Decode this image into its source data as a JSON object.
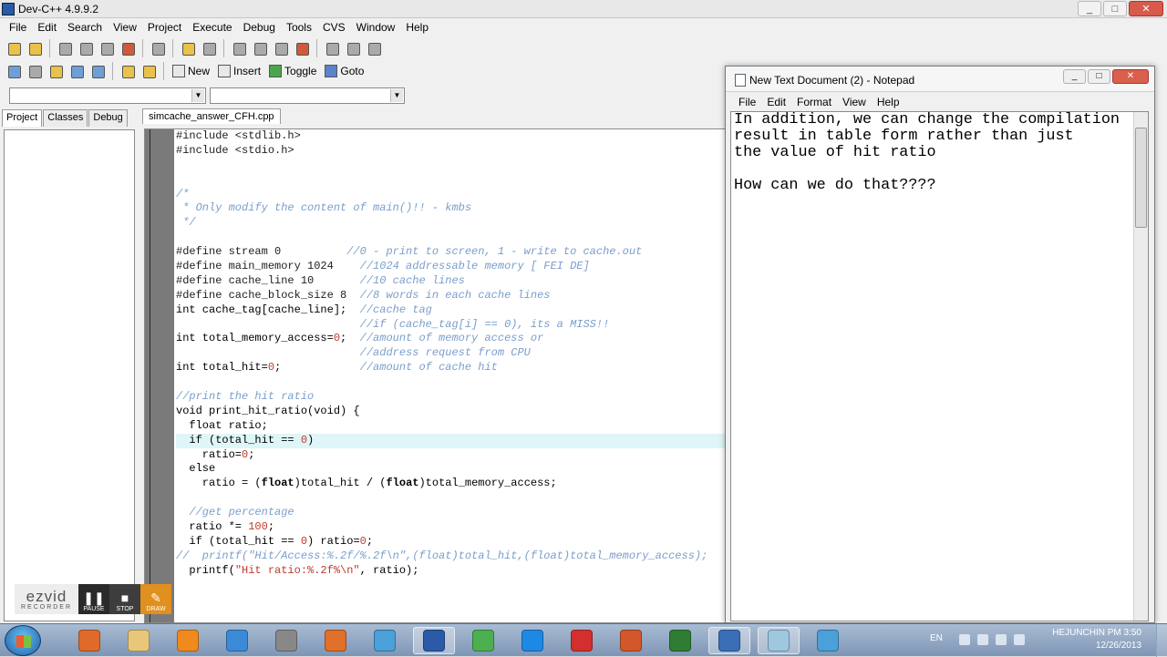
{
  "devcpp": {
    "title": "Dev-C++ 4.9.9.2",
    "window_buttons": [
      "_",
      "□",
      "✕"
    ],
    "menu": [
      "File",
      "Edit",
      "Search",
      "View",
      "Project",
      "Execute",
      "Debug",
      "Tools",
      "CVS",
      "Window",
      "Help"
    ],
    "toolbar2_labels": {
      "new": "New",
      "insert": "Insert",
      "toggle": "Toggle",
      "goto": "Goto"
    },
    "panel_tabs": [
      "Project",
      "Classes",
      "Debug"
    ],
    "file_tab": "simcache_answer_CFH.cpp"
  },
  "code_lines": [
    [
      [
        "pp",
        "#include <stdlib.h>"
      ]
    ],
    [
      [
        "pp",
        "#include <stdio.h>"
      ]
    ],
    [],
    [],
    [
      [
        "cm",
        "/*"
      ]
    ],
    [
      [
        "cm",
        " * Only modify the content of main()!! - kmbs"
      ]
    ],
    [
      [
        "cm",
        " */"
      ]
    ],
    [],
    [
      [
        "pp",
        "#define stream 0          "
      ],
      [
        "cm",
        "//0 - print to screen, 1 - write to cache.out"
      ]
    ],
    [
      [
        "pp",
        "#define main_memory 1024    "
      ],
      [
        "cm",
        "//1024 addressable memory [ FEI DE]"
      ]
    ],
    [
      [
        "pp",
        "#define cache_line 10       "
      ],
      [
        "cm",
        "//10 cache lines"
      ]
    ],
    [
      [
        "pp",
        "#define cache_block_size 8  "
      ],
      [
        "cm",
        "//8 words in each cache lines"
      ]
    ],
    [
      [
        "tx",
        "int cache_tag[cache_line];  "
      ],
      [
        "cm",
        "//cache tag"
      ]
    ],
    [
      [
        "tx",
        "                            "
      ],
      [
        "cm",
        "//if (cache_tag[i] == 0), its a MISS!!"
      ]
    ],
    [
      [
        "tx",
        "int total_memory_access="
      ],
      [
        "nm",
        "0"
      ],
      [
        "tx",
        ";  "
      ],
      [
        "cm",
        "//amount of memory access or"
      ]
    ],
    [
      [
        "tx",
        "                            "
      ],
      [
        "cm",
        "//address request from CPU"
      ]
    ],
    [
      [
        "tx",
        "int total_hit="
      ],
      [
        "nm",
        "0"
      ],
      [
        "tx",
        ";            "
      ],
      [
        "cm",
        "//amount of cache hit"
      ]
    ],
    [],
    [
      [
        "cm",
        "//print the hit ratio"
      ]
    ],
    [
      [
        "tx",
        "void print_hit_ratio(void) {"
      ]
    ],
    [
      [
        "tx",
        "  float ratio;"
      ]
    ],
    [
      [
        "tx",
        "  if (total_hit == "
      ],
      [
        "nm",
        "0"
      ],
      [
        "tx",
        ")"
      ]
    ],
    [
      [
        "tx",
        "    ratio="
      ],
      [
        "nm",
        "0"
      ],
      [
        "tx",
        ";"
      ]
    ],
    [
      [
        "tx",
        "  else"
      ]
    ],
    [
      [
        "tx",
        "    ratio = ("
      ],
      [
        "kw",
        "float"
      ],
      [
        "tx",
        ")total_hit / ("
      ],
      [
        "kw",
        "float"
      ],
      [
        "tx",
        ")total_memory_access;"
      ]
    ],
    [],
    [
      [
        "cm",
        "  //get percentage"
      ]
    ],
    [
      [
        "tx",
        "  ratio *= "
      ],
      [
        "nm",
        "100"
      ],
      [
        "tx",
        ";"
      ]
    ],
    [
      [
        "tx",
        "  if (total_hit == "
      ],
      [
        "nm",
        "0"
      ],
      [
        "tx",
        ") ratio="
      ],
      [
        "nm",
        "0"
      ],
      [
        "tx",
        ";"
      ]
    ],
    [
      [
        "cm",
        "//  printf(\"Hit/Access:%.2f/%.2f\\n\",(float)total_hit,(float)total_memory_access);"
      ]
    ],
    [
      [
        "tx",
        "  printf("
      ],
      [
        "st",
        "\"Hit ratio:%.2f%\\n\""
      ],
      [
        "tx",
        ", ratio);"
      ]
    ]
  ],
  "highlighted_line": 21,
  "notepad": {
    "title": "New Text Document (2) - Notepad",
    "menu": [
      "File",
      "Edit",
      "Format",
      "View",
      "Help"
    ],
    "text": "In addition, we can change the compilation\nresult in table form rather than just\nthe value of hit ratio\n\nHow can we do that????"
  },
  "ezvid": {
    "logo": "ezvid",
    "logo_sub": "RECORDER",
    "buttons": [
      "PAUSE",
      "STOP",
      "DRAW"
    ]
  },
  "taskbar": {
    "lang": "EN",
    "clock_line1": "HEJUNCHIN PM 3:50",
    "clock_line2": "12/26/2013",
    "apps": [
      {
        "name": "presentation-app",
        "color": "#e06a2a"
      },
      {
        "name": "explorer",
        "color": "#e8c77a"
      },
      {
        "name": "media-player",
        "color": "#f08a1e"
      },
      {
        "name": "internet-explorer",
        "color": "#3b8ad8"
      },
      {
        "name": "film-app",
        "color": "#888888"
      },
      {
        "name": "firefox",
        "color": "#e0702a"
      },
      {
        "name": "tool-app",
        "color": "#4aa0d8"
      },
      {
        "name": "word",
        "color": "#2a5aa8"
      },
      {
        "name": "chrome",
        "color": "#4caf50"
      },
      {
        "name": "quicktime",
        "color": "#1e88e5"
      },
      {
        "name": "acrobat",
        "color": "#d32f2f"
      },
      {
        "name": "powerpoint",
        "color": "#d2572a"
      },
      {
        "name": "terminal-app",
        "color": "#2f7d32"
      },
      {
        "name": "dev-cpp",
        "color": "#3a6fb8"
      },
      {
        "name": "notepad",
        "color": "#9ec8e0"
      },
      {
        "name": "tool-app-2",
        "color": "#4aa0d8"
      }
    ]
  }
}
